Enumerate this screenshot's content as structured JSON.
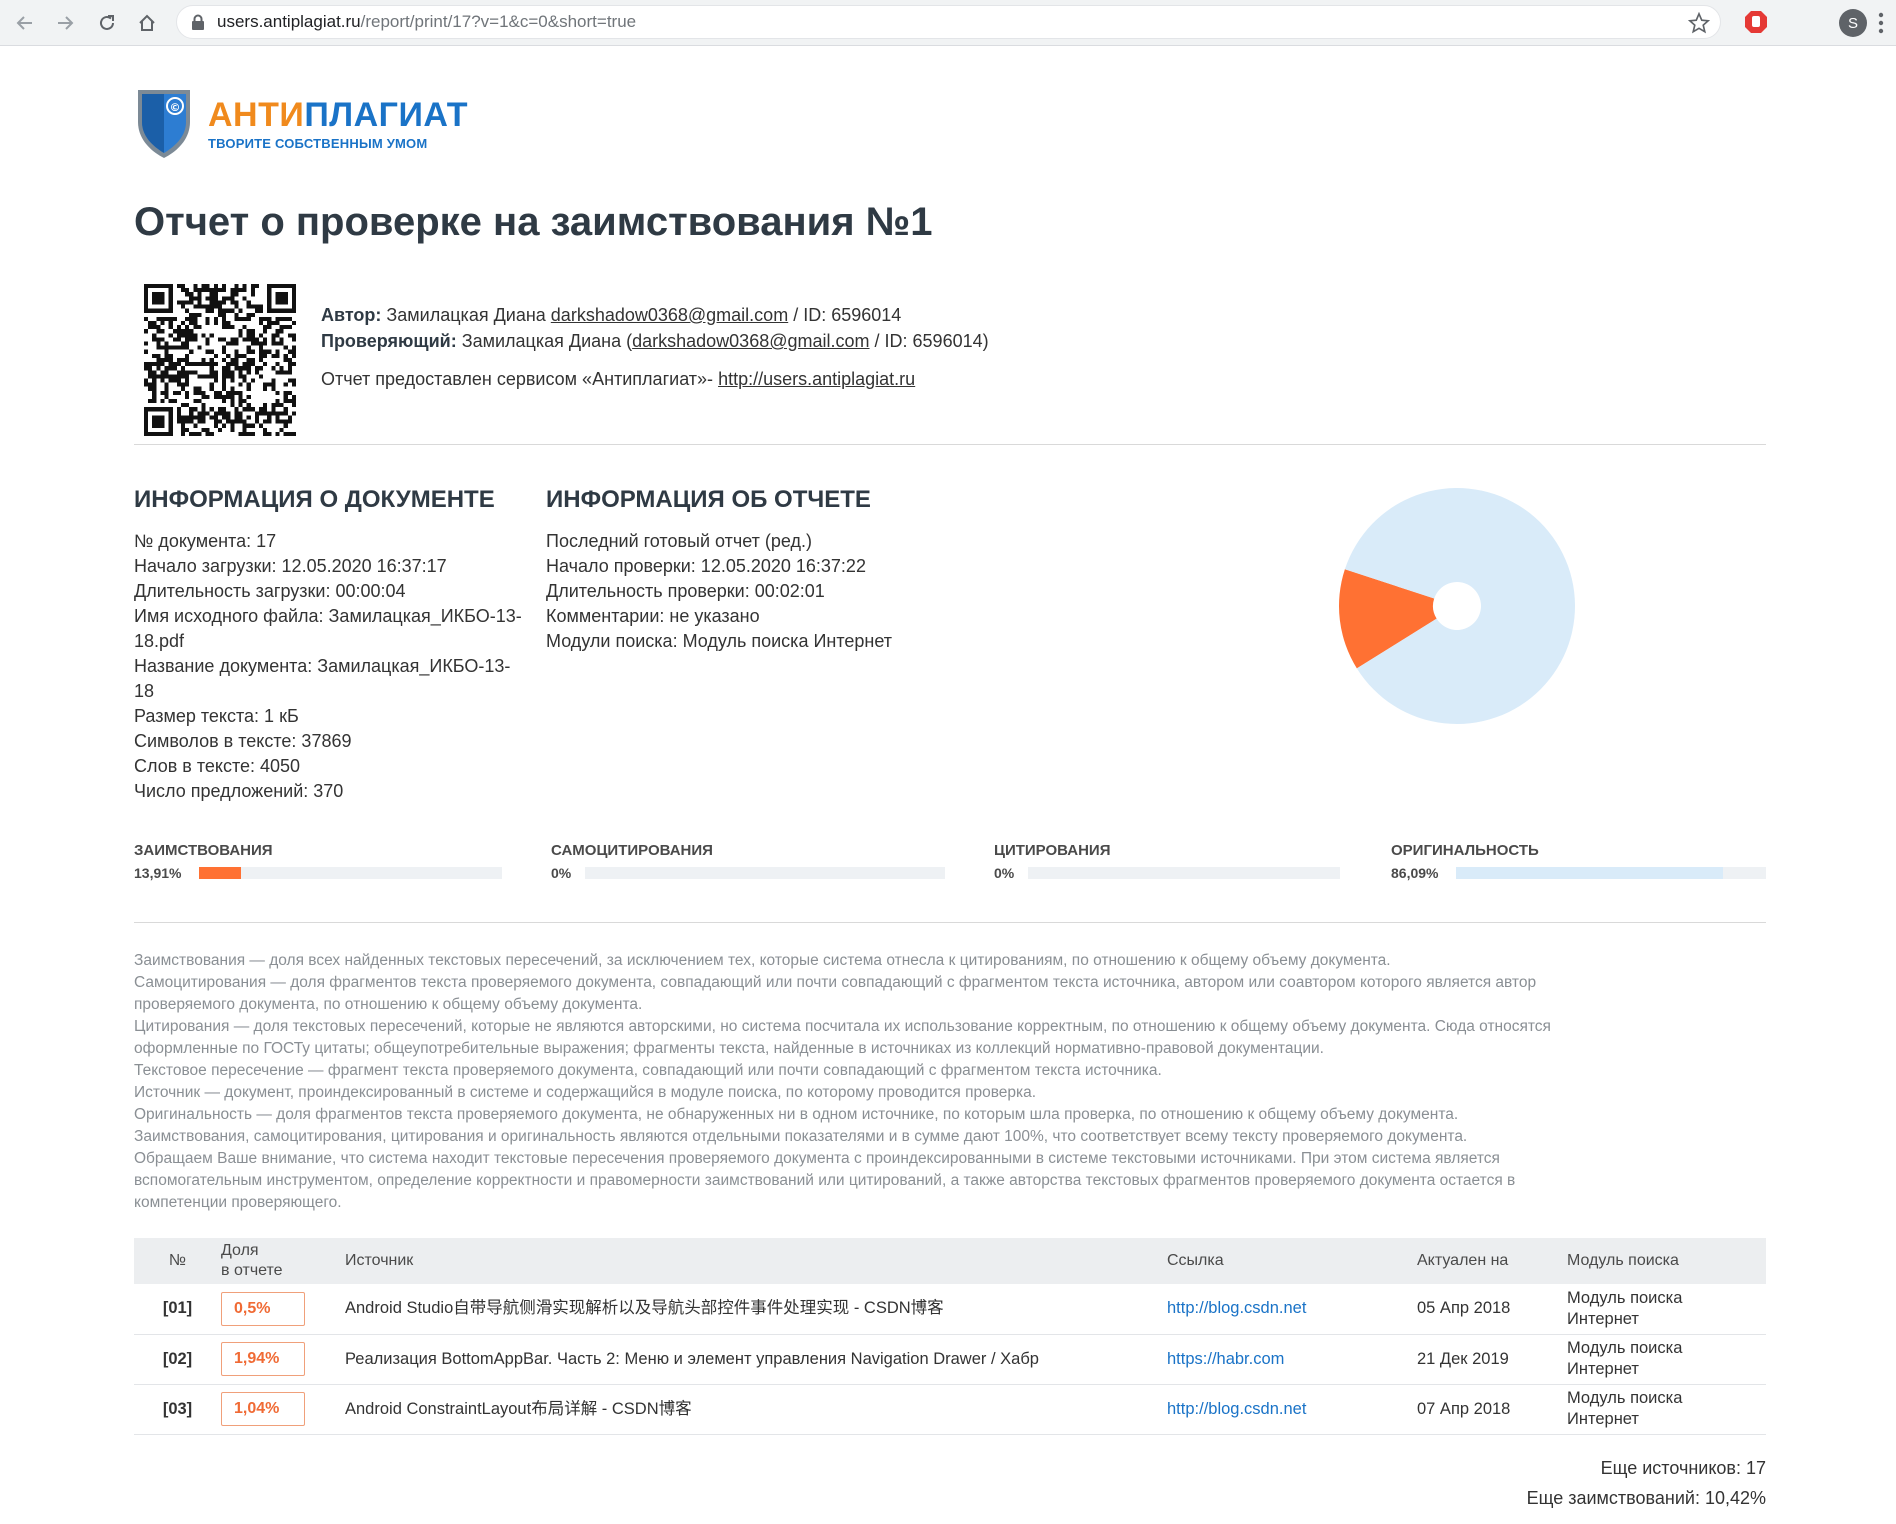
{
  "browser": {
    "url_host": "users.antiplagiat.ru",
    "url_path": "/report/print/17?v=1&c=0&short=true",
    "profile_initial": "S",
    "icons": [
      "back-arrow-icon",
      "forward-arrow-icon",
      "reload-icon",
      "home-icon",
      "lock-icon",
      "star-icon",
      "extension-icon",
      "kebab-menu-icon"
    ]
  },
  "logo": {
    "name_orange": "АНТИ",
    "name_blue": "ПЛАГИАТ",
    "tagline": "ТВОРИТЕ СОБСТВЕННЫМ УМОМ",
    "shield_symbol": "©"
  },
  "report": {
    "title": "Отчет о проверке на заимствования №1",
    "author_label": "Автор:",
    "author_name": "Замилацкая Диана",
    "author_email": "darkshadow0368@gmail.com",
    "author_id": "/ ID: 6596014",
    "reviewer_label": "Проверяющий:",
    "reviewer_name": "Замилацкая Диана (",
    "reviewer_email": "darkshadow0368@gmail.com",
    "reviewer_id": "/ ID: 6596014)",
    "provided_text": "Отчет предоставлен сервисом «Антиплагиат»- ",
    "provided_link": "http://users.antiplagiat.ru"
  },
  "doc_info": {
    "heading": "ИНФОРМАЦИЯ О ДОКУМЕНТЕ",
    "lines": [
      "№ документа: 17",
      "Начало загрузки: 12.05.2020 16:37:17",
      "Длительность загрузки: 00:00:04",
      "Имя исходного файла: Замилацкая_ИКБО-13-",
      "18.pdf",
      "Название документа: Замилацкая_ИКБО-13-",
      "18",
      "Размер текста: 1 кБ",
      "Символов в тексте: 37869",
      "Слов в тексте: 4050",
      "Число предложений: 370"
    ]
  },
  "report_info": {
    "heading": "ИНФОРМАЦИЯ ОБ ОТЧЕТЕ",
    "lines": [
      "Последний готовый отчет (ред.)",
      "Начало проверки: 12.05.2020 16:37:22",
      "Длительность проверки: 00:02:01",
      "Комментарии: не указано",
      "Модули поиска: Модуль поиска Интернет"
    ]
  },
  "chart_data": {
    "type": "pie",
    "donut": true,
    "slices": [
      {
        "label": "ЗАИМСТВОВАНИЯ",
        "value": 13.91,
        "color": "#ff7133"
      },
      {
        "label": "ОРИГИНАЛЬНОСТЬ",
        "value": 86.09,
        "color": "#d9ebf9"
      }
    ]
  },
  "metrics": [
    {
      "label": "ЗАИМСТВОВАНИЯ",
      "value": "13,91%",
      "fraction": 0.1391,
      "color": "#ff7133"
    },
    {
      "label": "САМОЦИТИРОВАНИЯ",
      "value": "0%",
      "fraction": 0,
      "color": "#f6c143"
    },
    {
      "label": "ЦИТИРОВАНИЯ",
      "value": "0%",
      "fraction": 0,
      "color": "#5dbf63"
    },
    {
      "label": "ОРИГИНАЛЬНОСТЬ",
      "value": "86,09%",
      "fraction": 0.8609,
      "color": "#d9ebf9"
    }
  ],
  "glossary": [
    "Заимствования — доля всех найденных текстовых пересечений, за исключением тех, которые система отнесла к цитированиям, по отношению к общему объему документа.",
    "Самоцитирования — доля фрагментов текста проверяемого документа, совпадающий или почти совпадающий с фрагментом текста источника, автором или соавтором которого является автор",
    "проверяемого документа, по отношению к общему объему документа.",
    "Цитирования — доля текстовых пересечений, которые не являются авторскими, но система посчитала их использование корректным, по отношению к общему объему документа. Сюда относятся",
    "оформленные по ГОСТу цитаты; общеупотребительные выражения; фрагменты текста, найденные в источниках из коллекций нормативно-правовой документации.",
    "Текстовое пересечение — фрагмент текста проверяемого документа, совпадающий или почти совпадающий с фрагментом текста источника.",
    "Источник — документ, проиндексированный в системе и содержащийся в модуле поиска, по которому проводится проверка.",
    "Оригинальность — доля фрагментов текста проверяемого документа, не обнаруженных ни в одном источнике, по которым шла проверка, по отношению к общему объему документа.",
    "Заимствования, самоцитирования, цитирования и оригинальность являются отдельными показателями и в сумме дают 100%, что соответствует всему тексту проверяемого документа.",
    "Обращаем Ваше внимание, что система находит текстовые пересечения проверяемого документа с проиндексированными в системе текстовыми источниками. При этом система является",
    "вспомогательным инструментом, определение корректности и правомерности заимствований или цитирований, а также авторства текстовых фрагментов проверяемого документа остается в",
    "компетенции проверяющего."
  ],
  "table": {
    "headers": {
      "no": "№",
      "share_line1": "Доля",
      "share_line2": "в отчете",
      "source": "Источник",
      "link": "Ссылка",
      "date": "Актуален на",
      "module": "Модуль поиска"
    },
    "rows": [
      {
        "no": "[01]",
        "share": "0,5%",
        "source": "Android Studio自带导航侧滑实现解析以及导航头部控件事件处理实现 - CSDN博客",
        "link": "http://blog.csdn.net",
        "date": "05 Апр 2018",
        "module_line1": "Модуль поиска",
        "module_line2": "Интернет"
      },
      {
        "no": "[02]",
        "share": "1,94%",
        "source": "Реализация BottomAppBar. Часть 2: Меню и элемент управления Navigation Drawer / Хабр",
        "link": "https://habr.com",
        "date": "21 Дек 2019",
        "module_line1": "Модуль поиска",
        "module_line2": "Интернет"
      },
      {
        "no": "[03]",
        "share": "1,04%",
        "source": "Android ConstraintLayout布局详解 - CSDN博客",
        "link": "http://blog.csdn.net",
        "date": "07 Апр 2018",
        "module_line1": "Модуль поиска",
        "module_line2": "Интернет"
      }
    ]
  },
  "summary": {
    "more_sources": "Еще источников: 17",
    "more_borrowings": "Еще заимствований: 10,42%"
  }
}
